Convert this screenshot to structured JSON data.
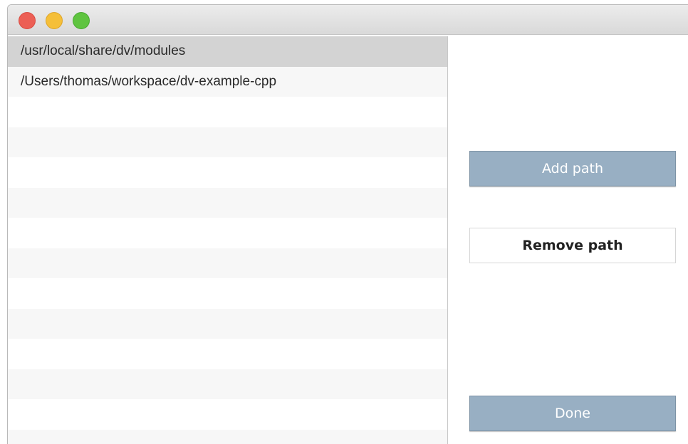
{
  "window": {
    "controls": [
      "close",
      "minimize",
      "zoom"
    ]
  },
  "path_list": {
    "items": [
      {
        "path": "/usr/local/share/dv/modules",
        "selected": true
      },
      {
        "path": "/Users/thomas/workspace/dv-example-cpp",
        "selected": false
      },
      {
        "path": "",
        "selected": false
      },
      {
        "path": "",
        "selected": false
      },
      {
        "path": "",
        "selected": false
      },
      {
        "path": "",
        "selected": false
      },
      {
        "path": "",
        "selected": false
      },
      {
        "path": "",
        "selected": false
      },
      {
        "path": "",
        "selected": false
      },
      {
        "path": "",
        "selected": false
      },
      {
        "path": "",
        "selected": false
      },
      {
        "path": "",
        "selected": false
      },
      {
        "path": "",
        "selected": false
      },
      {
        "path": "",
        "selected": false
      }
    ]
  },
  "buttons": {
    "add_label": "Add path",
    "remove_label": "Remove path",
    "done_label": "Done"
  },
  "colors": {
    "primary_button": "#98afc3",
    "selection": "#d3d3d3",
    "close": "#ec5f55",
    "minimize": "#f5bf39",
    "zoom": "#5fc440"
  }
}
